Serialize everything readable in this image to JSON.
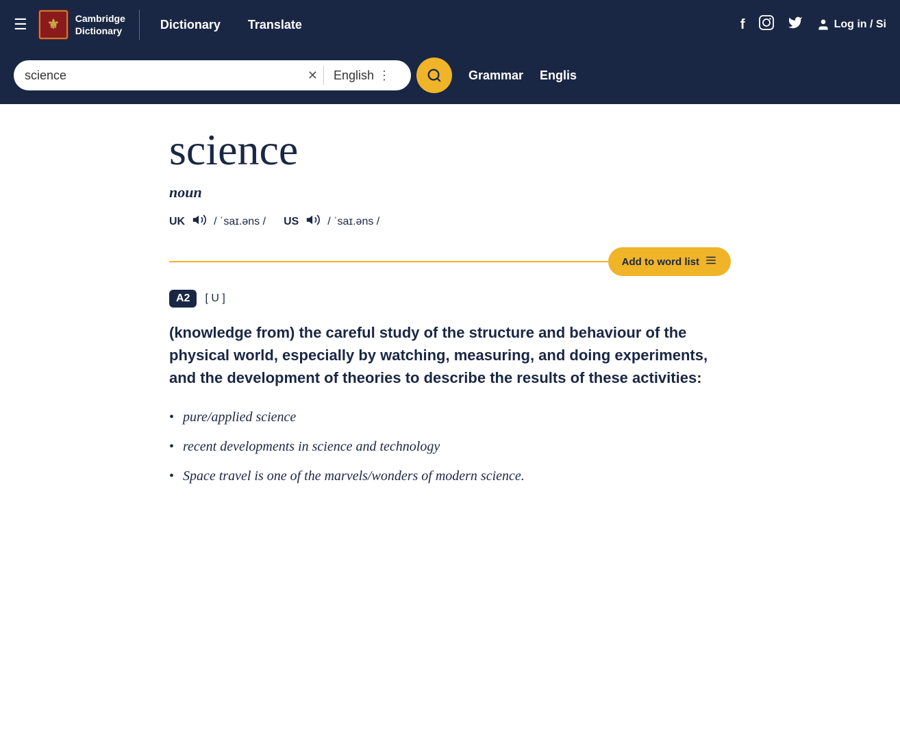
{
  "navbar": {
    "logo_line1": "Cambridge",
    "logo_line2": "Dictionary",
    "nav_dict": "Dictionary",
    "nav_translate": "Translate",
    "nav_login": "Log in / Si",
    "hamburger_icon": "☰",
    "facebook_icon": "f",
    "instagram_icon": "◻",
    "twitter_icon": "🐦",
    "user_icon": "👤"
  },
  "search": {
    "query": "science",
    "language": "English",
    "clear_icon": "✕",
    "dots_icon": "⋮",
    "search_icon": "🔍",
    "grammar_label": "Grammar",
    "english_label": "Englis"
  },
  "entry": {
    "word": "science",
    "pos": "noun",
    "uk_label": "UK",
    "us_label": "US",
    "uk_pron": "/ ˈsaɪ.əns /",
    "us_pron": "/ ˈsaɪ.əns /",
    "speaker_icon": "🔊",
    "add_to_wordlist": "Add to word list",
    "list_icon": "≡",
    "level": "A2",
    "grammar": "[ U ]",
    "definition": "(knowledge from) the careful study of the structure and behaviour of the physical world, especially by watching, measuring, and doing experiments, and the development of theories to describe the results of these activities:",
    "examples": [
      "pure/applied science",
      "recent developments in science and technology",
      "Space travel is one of the marvels/wonders of modern science."
    ]
  }
}
